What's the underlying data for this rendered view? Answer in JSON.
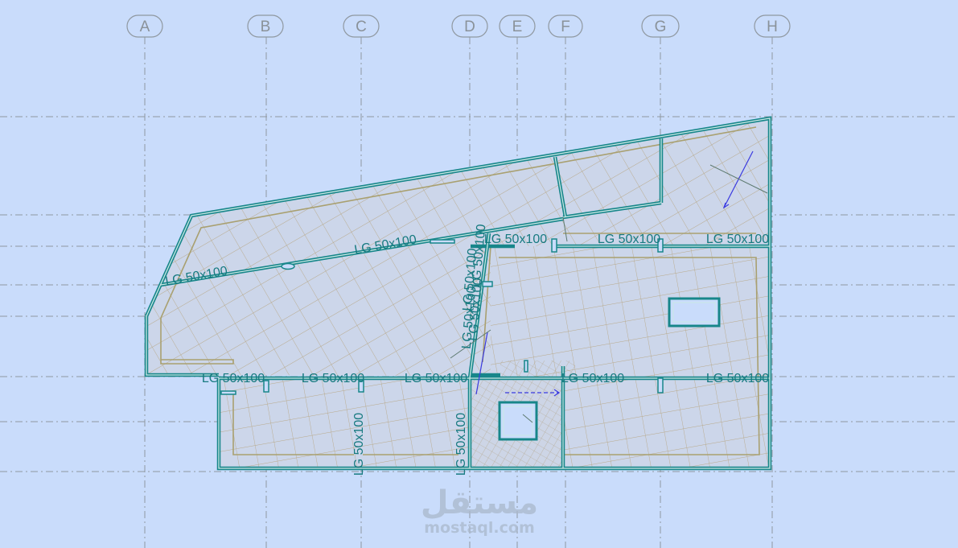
{
  "grid_axes": [
    {
      "id": "A",
      "label": "A"
    },
    {
      "id": "B",
      "label": "B"
    },
    {
      "id": "C",
      "label": "C"
    },
    {
      "id": "D",
      "label": "D"
    },
    {
      "id": "E",
      "label": "E"
    },
    {
      "id": "F",
      "label": "F"
    },
    {
      "id": "G",
      "label": "G"
    },
    {
      "id": "H",
      "label": "H"
    }
  ],
  "beam_labels": [
    "LG 50x100",
    "LG 50x100",
    "LG 50x100",
    "LG 50x100",
    "LG 50x100",
    "LG 50x100",
    "LG 50x100",
    "LG 50x100",
    "LG 50x100",
    "LG 50x100",
    "LG 50x100",
    "LG 50x100",
    "LG 50x100",
    "LG 50x100",
    "LG 50x100",
    "LG 50x100"
  ],
  "watermark": {
    "arabic": "مستقل",
    "latin": "mostaql.com"
  },
  "colors": {
    "background": "#c9dcfb",
    "slab_fill": "#ccd6ea",
    "beam": "#17868a",
    "beam_inner": "#3aa8a2",
    "mesh": "#b8a98a",
    "slab_edge": "#a9a070",
    "grid_line": "#8f98a0",
    "label": "#177a80",
    "arrow": "#3a3ae0"
  }
}
